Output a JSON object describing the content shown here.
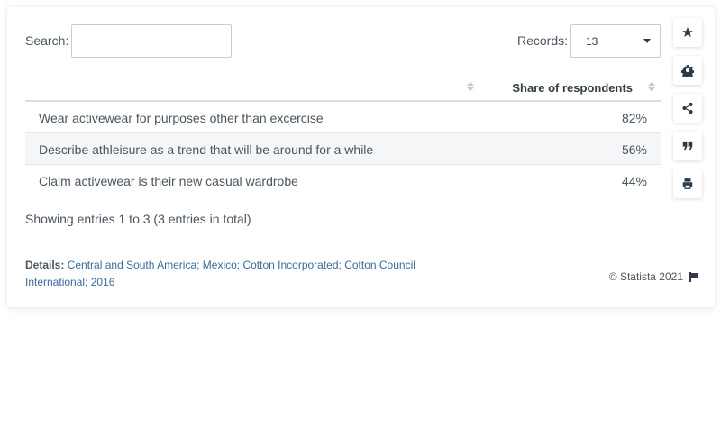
{
  "search": {
    "label": "Search:",
    "value": "",
    "placeholder": ""
  },
  "records": {
    "label": "Records:",
    "value": "13"
  },
  "table": {
    "header": {
      "value_col": "Share of respondents"
    },
    "rows": [
      {
        "label": "Wear activewear for purposes other than excercise",
        "value": "82%"
      },
      {
        "label": "Describe athleisure as a trend that will be around for a while",
        "value": "56%"
      },
      {
        "label": "Claim activewear is their new casual wardrobe",
        "value": "44%"
      }
    ]
  },
  "footer": {
    "showing": "Showing entries 1 to 3 (3 entries in total)",
    "details_label": "Details:",
    "details_text": "Central and South America; Mexico; Cotton Incorporated; Cotton Council International; 2016",
    "copyright": "© Statista 2021"
  },
  "toolbar": {
    "buttons": [
      "star-icon",
      "gear-icon",
      "share-icon",
      "quote-icon",
      "print-icon"
    ]
  },
  "chart_data": {
    "type": "table",
    "columns": [
      "",
      "Share of respondents"
    ],
    "categories": [
      "Wear activewear for purposes other than excercise",
      "Describe athleisure as a trend that will be around for a while",
      "Claim activewear is their new casual wardrobe"
    ],
    "values": [
      82,
      56,
      44
    ],
    "unit": "%"
  }
}
